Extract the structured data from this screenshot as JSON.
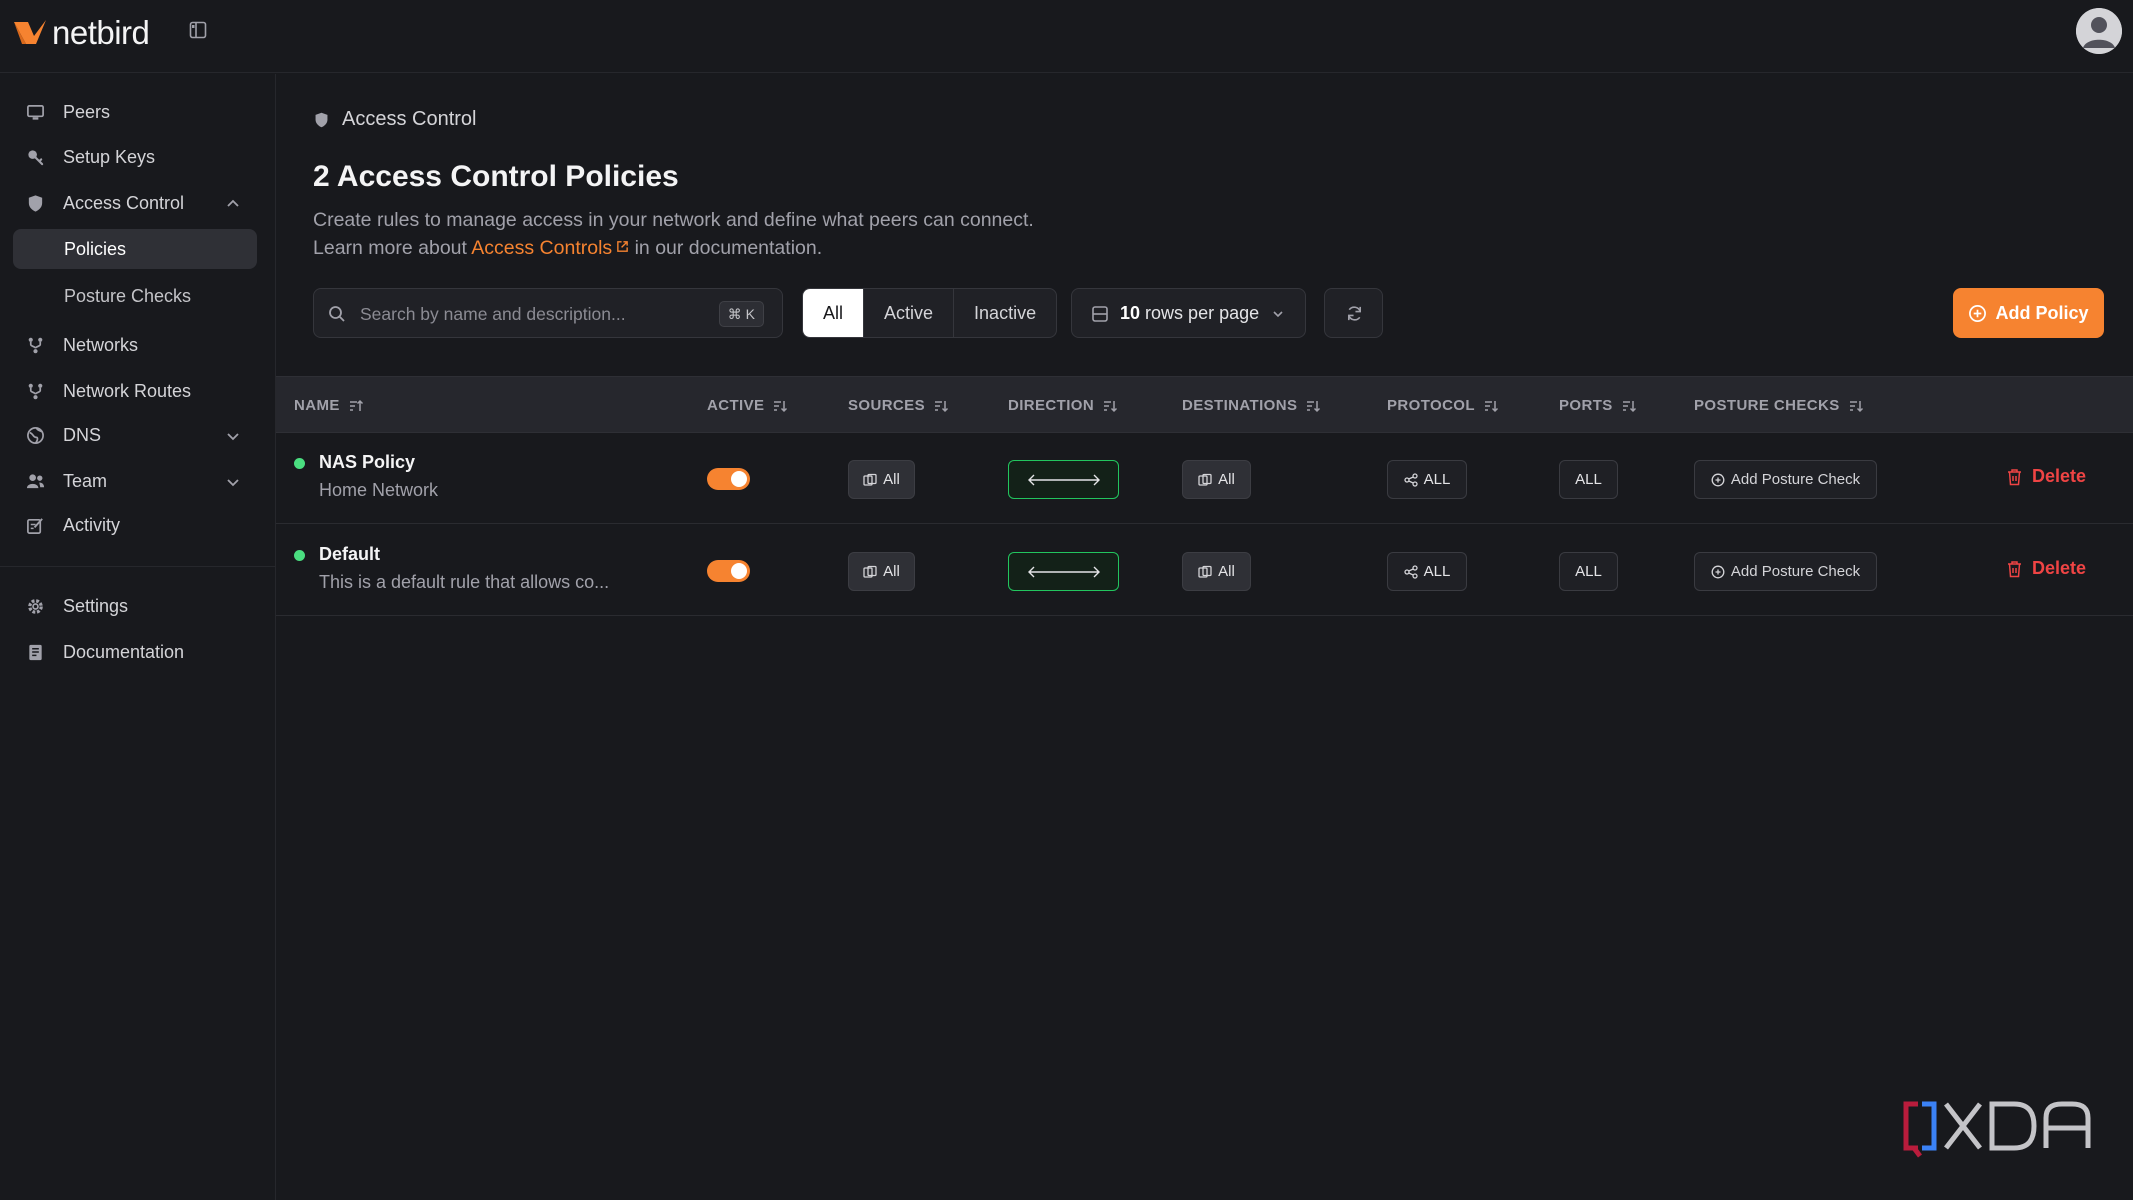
{
  "brand": {
    "name": "netbird",
    "accent": "#f68330"
  },
  "sidebar": {
    "items": [
      {
        "label": "Peers",
        "icon": "monitor-icon"
      },
      {
        "label": "Setup Keys",
        "icon": "key-icon"
      },
      {
        "label": "Access Control",
        "icon": "shield-icon",
        "expanded": true
      },
      {
        "label": "Networks",
        "icon": "network-icon"
      },
      {
        "label": "Network Routes",
        "icon": "route-icon"
      },
      {
        "label": "DNS",
        "icon": "globe-icon"
      },
      {
        "label": "Team",
        "icon": "users-icon"
      },
      {
        "label": "Activity",
        "icon": "activity-icon"
      },
      {
        "label": "Settings",
        "icon": "gear-icon"
      },
      {
        "label": "Documentation",
        "icon": "book-icon"
      }
    ],
    "subitems": [
      {
        "label": "Policies",
        "active": true
      },
      {
        "label": "Posture Checks",
        "active": false
      }
    ]
  },
  "breadcrumb": {
    "label": "Access Control"
  },
  "page": {
    "title": "2 Access Control Policies",
    "description_line1": "Create rules to manage access in your network and define what peers can connect.",
    "learn_prefix": "Learn more about",
    "learn_link": "Access Controls",
    "learn_suffix": "in our documentation."
  },
  "toolbar": {
    "search_placeholder": "Search by name and description...",
    "search_shortcut": "⌘ K",
    "filters": [
      "All",
      "Active",
      "Inactive"
    ],
    "active_filter": "All",
    "rows_count": "10",
    "rows_suffix": "rows per page",
    "add_label": "Add Policy"
  },
  "table": {
    "columns": [
      "NAME",
      "ACTIVE",
      "SOURCES",
      "DIRECTION",
      "DESTINATIONS",
      "PROTOCOL",
      "PORTS",
      "POSTURE CHECKS"
    ],
    "rows": [
      {
        "name": "NAS Policy",
        "description": "Home Network",
        "active": true,
        "sources": "All",
        "direction": "bidirectional",
        "destinations": "All",
        "protocol": "ALL",
        "ports": "ALL",
        "posture": "Add Posture Check",
        "delete": "Delete"
      },
      {
        "name": "Default",
        "description": "This is a default rule that allows co...",
        "active": true,
        "sources": "All",
        "direction": "bidirectional",
        "destinations": "All",
        "protocol": "ALL",
        "ports": "ALL",
        "posture": "Add Posture Check",
        "delete": "Delete"
      }
    ]
  },
  "watermark": {
    "text": "XDA"
  }
}
